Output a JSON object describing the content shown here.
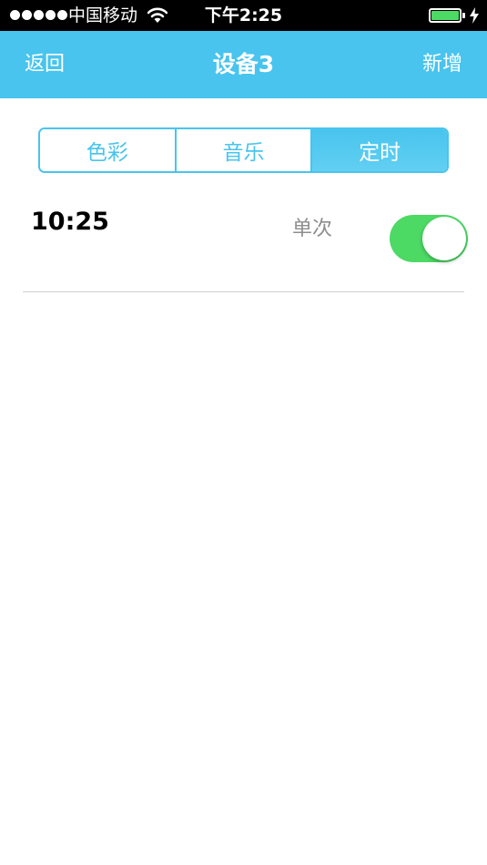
{
  "status_bar": {
    "carrier": "中国移动",
    "time": "下午2:25",
    "signal_bars": 5,
    "battery_level": 1.0,
    "charging": true,
    "battery_color": "#4cd964"
  },
  "nav": {
    "back_label": "返回",
    "title": "设备3",
    "add_label": "新增",
    "background_color": "#48c4ee"
  },
  "tabs": [
    {
      "label": "色彩",
      "active": false
    },
    {
      "label": "音乐",
      "active": false
    },
    {
      "label": "定时",
      "active": true
    }
  ],
  "timers": [
    {
      "time": "10:25",
      "repeat": "单次",
      "enabled": true
    }
  ],
  "colors": {
    "accent": "#48c4ee",
    "toggle_on": "#4cd964"
  }
}
